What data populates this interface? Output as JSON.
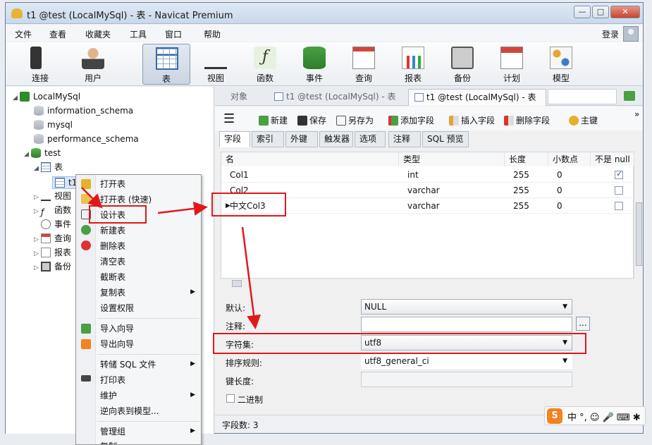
{
  "window": {
    "title": "t1 @test (LocalMySql) - 表 - Navicat Premium",
    "minimize": "—",
    "maximize": "□",
    "close": "✕"
  },
  "menu": {
    "items": [
      "文件",
      "查看",
      "收藏夹",
      "工具",
      "窗口",
      "帮助"
    ],
    "login": "登录"
  },
  "toolbar": {
    "items": [
      {
        "label": "连接",
        "icon": "plug-icon"
      },
      {
        "label": "用户",
        "icon": "user-icon"
      },
      {
        "label": "表",
        "icon": "table-icon",
        "active": true
      },
      {
        "label": "视图",
        "icon": "glasses-icon"
      },
      {
        "label": "函数",
        "icon": "function-icon"
      },
      {
        "label": "事件",
        "icon": "database-event-icon"
      },
      {
        "label": "查询",
        "icon": "query-icon"
      },
      {
        "label": "报表",
        "icon": "report-icon"
      },
      {
        "label": "备份",
        "icon": "backup-icon"
      },
      {
        "label": "计划",
        "icon": "calendar-icon"
      },
      {
        "label": "模型",
        "icon": "model-icon"
      }
    ]
  },
  "tree": {
    "connection": "LocalMySql",
    "databases": [
      "information_schema",
      "mysql",
      "performance_schema",
      "test"
    ],
    "tables_folder": "表",
    "selected_table": "t1",
    "folders": [
      "视图",
      "函数",
      "事件",
      "查询",
      "报表",
      "备份"
    ]
  },
  "context_menu": {
    "items": [
      "打开表",
      "打开表 (快速)",
      "设计表",
      "新建表",
      "删除表",
      "清空表",
      "截断表",
      "复制表",
      "设置权限",
      "导入向导",
      "导出向导",
      "转储 SQL 文件",
      "打印表",
      "维护",
      "逆向表到模型...",
      "管理组",
      "复制"
    ]
  },
  "doc_tabs": {
    "object": "对象",
    "tab1": "t1 @test (LocalMySql) - 表",
    "tab2": "t1 @test (LocalMySql) - 表"
  },
  "design_toolbar": {
    "menu": "☰",
    "new": "新建",
    "save": "保存",
    "save_as": "另存为",
    "add_field": "添加字段",
    "insert_field": "插入字段",
    "delete_field": "删除字段",
    "primary_key": "主键",
    "more": "»"
  },
  "sub_tabs": [
    "字段",
    "索引",
    "外键",
    "触发器",
    "选项",
    "注释",
    "SQL 预览"
  ],
  "fields_grid": {
    "headers": [
      "名",
      "类型",
      "长度",
      "小数点",
      "不是 null"
    ],
    "rows": [
      {
        "name": "Col1",
        "type": "int",
        "length": "255",
        "decimals": "0",
        "not_null": true
      },
      {
        "name": "Col2",
        "type": "varchar",
        "length": "255",
        "decimals": "0",
        "not_null": false
      },
      {
        "name": "中文Col3",
        "type": "varchar",
        "length": "255",
        "decimals": "0",
        "not_null": false
      }
    ]
  },
  "props": {
    "default_label": "默认:",
    "default_value": "NULL",
    "comment_label": "注释:",
    "ellipsis": "...",
    "charset_label": "字符集:",
    "charset_value": "utf8",
    "collation_label": "排序规则:",
    "collation_value": "utf8_general_ci",
    "key_length_label": "键长度:",
    "binary_label": "二进制"
  },
  "status": {
    "field_count": "字段数: 3"
  },
  "ime": {
    "logo": "S",
    "text": "中 °, ☺ 🎤 ⌨ ✱"
  },
  "colors": {
    "annotation": "#e0181b",
    "selection": "#d8e6f7"
  }
}
